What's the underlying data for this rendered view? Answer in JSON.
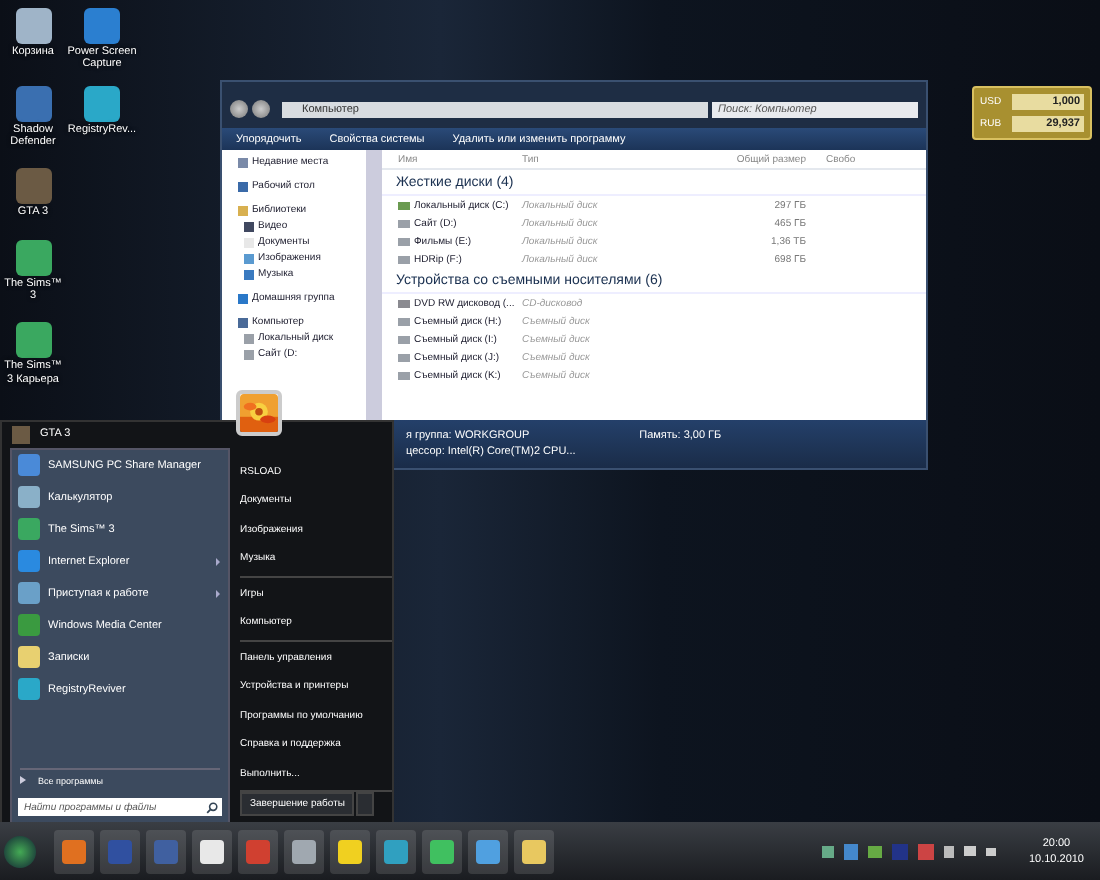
{
  "desktop_icons": [
    {
      "label": "Корзина",
      "kind": "bin"
    },
    {
      "label": "Power Screen Capture",
      "kind": "capture"
    },
    {
      "label": "Shadow Defender",
      "kind": "shield"
    },
    {
      "label": "RegistryRev...",
      "kind": "registry"
    },
    {
      "label": "GTA 3",
      "kind": "game"
    },
    {
      "label": "The Sims™ 3",
      "kind": "sims"
    },
    {
      "label": "The Sims™ 3 Карьера",
      "kind": "sims"
    }
  ],
  "currency_widget": {
    "rows": [
      {
        "code": "USD",
        "value": "1,000"
      },
      {
        "code": "RUB",
        "value": "29,937"
      }
    ]
  },
  "explorer": {
    "address": "Компьютер",
    "search": {
      "placeholder": "Поиск: Компьютер"
    },
    "toolbar": [
      "Упорядочить",
      "Свойства системы",
      "Удалить или изменить программу"
    ],
    "nav": [
      {
        "label": "Недавние места",
        "kind": "recent"
      },
      {
        "label": "Рабочий стол",
        "kind": "desktop"
      },
      {
        "label": "Библиотеки",
        "kind": "library",
        "children": [
          {
            "label": "Видео",
            "kind": "video"
          },
          {
            "label": "Документы",
            "kind": "docs"
          },
          {
            "label": "Изображения",
            "kind": "images"
          },
          {
            "label": "Музыка",
            "kind": "music"
          }
        ]
      },
      {
        "label": "Домашняя группа",
        "kind": "home"
      },
      {
        "label": "Компьютер",
        "kind": "computer",
        "children": [
          {
            "label": "Локальный диск",
            "kind": "drive"
          },
          {
            "label": "Сайт (D:",
            "kind": "drive"
          }
        ]
      }
    ],
    "columns": [
      "Имя",
      "Тип",
      "Общий размер",
      "Свобо"
    ],
    "groups": [
      {
        "title": "Жесткие диски (4)",
        "items": [
          {
            "name": "Локальный диск (C:)",
            "type": "Локальный диск",
            "size": "297 ГБ",
            "kind": "system"
          },
          {
            "name": "Сайт (D:)",
            "type": "Локальный диск",
            "size": "465 ГБ",
            "kind": "drive"
          },
          {
            "name": "Фильмы (E:)",
            "type": "Локальный диск",
            "size": "1,36 ТБ",
            "kind": "drive"
          },
          {
            "name": "HDRip (F:)",
            "type": "Локальный диск",
            "size": "698 ГБ",
            "kind": "drive"
          }
        ]
      },
      {
        "title": "Устройства со съемными носителями (6)",
        "items": [
          {
            "name": "DVD RW дисковод (...",
            "type": "CD-дисковод",
            "kind": "dvd"
          },
          {
            "name": "Съемный диск (H:)",
            "type": "Съемный диск",
            "kind": "drive"
          },
          {
            "name": "Съемный диск (I:)",
            "type": "Съемный диск",
            "kind": "drive"
          },
          {
            "name": "Съемный диск (J:)",
            "type": "Съемный диск",
            "kind": "drive"
          },
          {
            "name": "Съемный диск (K:)",
            "type": "Съемный диск",
            "kind": "drive"
          }
        ]
      }
    ],
    "status": {
      "workgroup": "я группа: WORKGROUP",
      "memory": "Память: 3,00 ГБ",
      "cpu": "цессор: Intel(R) Core(TM)2 CPU..."
    }
  },
  "start_menu": {
    "pinned": {
      "label": "GTA 3",
      "kind": "game"
    },
    "programs": [
      {
        "label": "SAMSUNG PC Share Manager",
        "kind": "samsung",
        "submenu": false
      },
      {
        "label": "Калькулятор",
        "kind": "calc",
        "submenu": false
      },
      {
        "label": "The Sims™ 3",
        "kind": "sims",
        "submenu": false
      },
      {
        "label": "Internet Explorer",
        "kind": "ie",
        "submenu": true
      },
      {
        "label": "Приступая к работе",
        "kind": "start",
        "submenu": true
      },
      {
        "label": "Windows Media Center",
        "kind": "wmc",
        "submenu": false
      },
      {
        "label": "Записки",
        "kind": "notes",
        "submenu": false
      },
      {
        "label": "RegistryReviver",
        "kind": "registry",
        "submenu": false
      }
    ],
    "all_programs": "Все программы",
    "search": {
      "placeholder": "Найти программы и файлы"
    },
    "right_groups": [
      [
        "RSLOAD",
        "Документы",
        "Изображения",
        "Музыка"
      ],
      [
        "Игры",
        "Компьютер"
      ],
      [
        "Панель управления",
        "Устройства и принтеры",
        "Программы по умолчанию",
        "Справка и поддержка",
        "Выполнить..."
      ]
    ],
    "shutdown": "Завершение работы"
  },
  "taskbar": {
    "clock": {
      "time": "20:00",
      "date": "10.10.2010"
    }
  }
}
